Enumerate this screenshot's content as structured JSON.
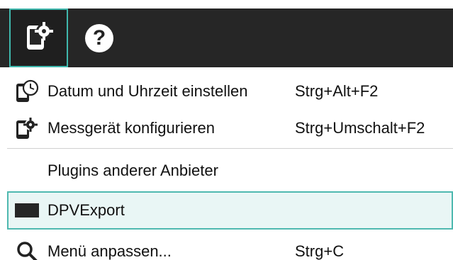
{
  "colors": {
    "toolbar_bg": "#262626",
    "accent": "#3fb8ad",
    "highlight_bg": "#e9f6f5"
  },
  "toolbar": {
    "buttons": [
      {
        "icon": "device-settings-icon",
        "active": true
      },
      {
        "icon": "help-icon",
        "glyph": "?"
      }
    ]
  },
  "menu": {
    "items": [
      {
        "icon": "clock-device-icon",
        "label": "Datum und Uhrzeit einstellen",
        "shortcut": "Strg+Alt+F2"
      },
      {
        "icon": "device-settings-icon",
        "label": "Messgerät konfigurieren",
        "shortcut": "Strg+Umschalt+F2"
      },
      {
        "icon": "",
        "label": "Plugins anderer Anbieter",
        "shortcut": ""
      },
      {
        "icon": "export-icon",
        "label": "DPVExport",
        "shortcut": "",
        "highlighted": true
      },
      {
        "icon": "search-icon",
        "label": "Menü anpassen...",
        "shortcut": "Strg+C"
      }
    ]
  }
}
